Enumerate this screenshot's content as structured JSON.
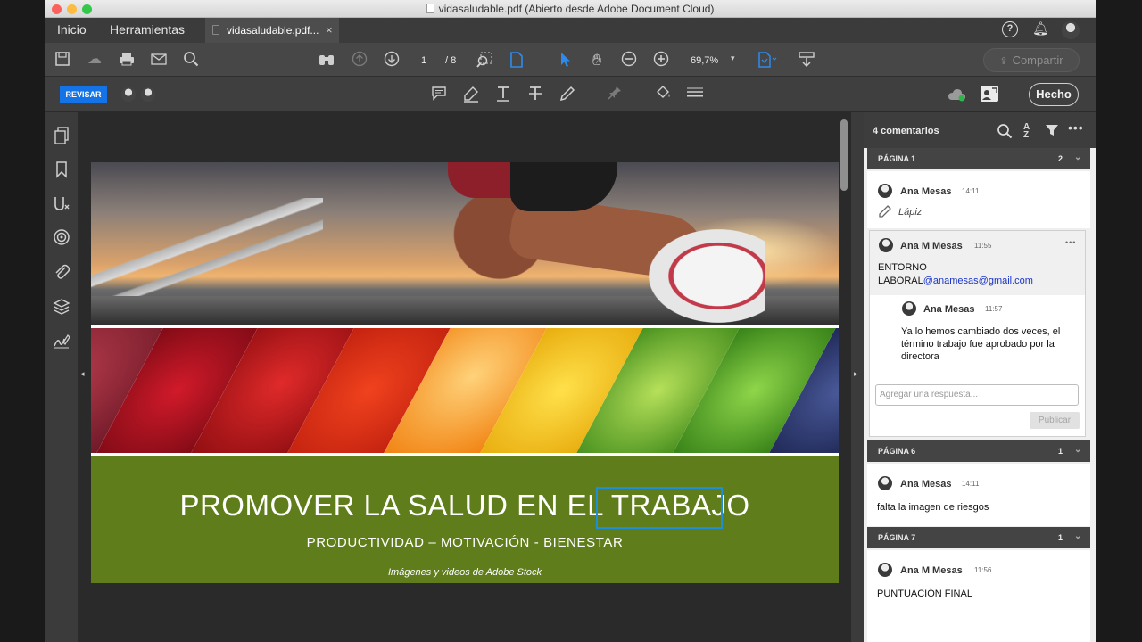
{
  "window": {
    "title": "vidasaludable.pdf (Abierto desde Adobe Document Cloud)",
    "traffic_colors": [
      "#fc605c",
      "#fdbc40",
      "#34c84a"
    ]
  },
  "tabs": {
    "home": "Inicio",
    "tools": "Herramientas",
    "document": "vidasaludable.pdf...",
    "close": "×"
  },
  "toolbar": {
    "page_current": "1",
    "page_total": "/ 8",
    "zoom": "69,7%",
    "share_label": "Compartir",
    "icons": [
      "save-icon",
      "upload-icon",
      "print-icon",
      "email-icon",
      "search-icon",
      "binoculars-icon",
      "prev-page-icon",
      "next-page-icon",
      "marquee-zoom-icon",
      "page-view-icon",
      "select-arrow-icon",
      "hand-icon",
      "zoom-out-icon",
      "zoom-in-icon",
      "page-layout-icon",
      "read-mode-icon"
    ]
  },
  "review_bar": {
    "review_label": "REVISAR",
    "done_label": "Hecho",
    "accent": "#1473e6",
    "icons": [
      "comment-icon",
      "highlight-icon",
      "text-underline-icon",
      "strikethrough-icon",
      "pencil-icon",
      "stamp-pin-icon",
      "fill-icon",
      "more-lines-icon",
      "cloud-status-icon",
      "share-people-icon"
    ]
  },
  "left_nav": {
    "icons": [
      "pages-icon",
      "bookmark-icon",
      "fill-sign-icon",
      "layers-target-icon",
      "attachment-icon",
      "stack-layers-icon",
      "signature-icon"
    ]
  },
  "document": {
    "headline_prefix": "PROMOVER LA SALUD EN EL ",
    "headline_highlight": "TRABAJO",
    "subheading": "PRODUCTIVIDAD – MOTIVACIÓN - BIENESTAR",
    "credit": "Imágenes y videos de Adobe Stock",
    "banner_color": "#5f7d1a",
    "highlight_color": "#1e8fd6"
  },
  "comments_panel": {
    "count_label": "4 comentarios",
    "sections": [
      {
        "header": "PÁGINA 1",
        "count": "2",
        "comments": [
          {
            "author": "Ana Mesas",
            "time": "14:11",
            "tool_label": "Lápiz"
          },
          {
            "author": "Ana M Mesas",
            "time": "11:55",
            "text_line1": "ENTORNO",
            "text_line2_prefix": "LABORAL",
            "email": "@anamesas@gmail.com",
            "reply": {
              "author": "Ana Mesas",
              "time": "11:57",
              "text": "Ya lo hemos cambiado dos veces, el término trabajo fue aprobado por la directora"
            },
            "reply_placeholder": "Agregar una respuesta...",
            "publish_label": "Publicar",
            "more": "•••"
          }
        ]
      },
      {
        "header": "PÁGINA 6",
        "count": "1",
        "comments": [
          {
            "author": "Ana Mesas",
            "time": "14:11",
            "text": "falta la imagen de riesgos"
          }
        ]
      },
      {
        "header": "PÁGINA 7",
        "count": "1",
        "comments": [
          {
            "author": "Ana M Mesas",
            "time": "11:56",
            "text": "PUNTUACIÓN FINAL"
          }
        ]
      }
    ]
  }
}
